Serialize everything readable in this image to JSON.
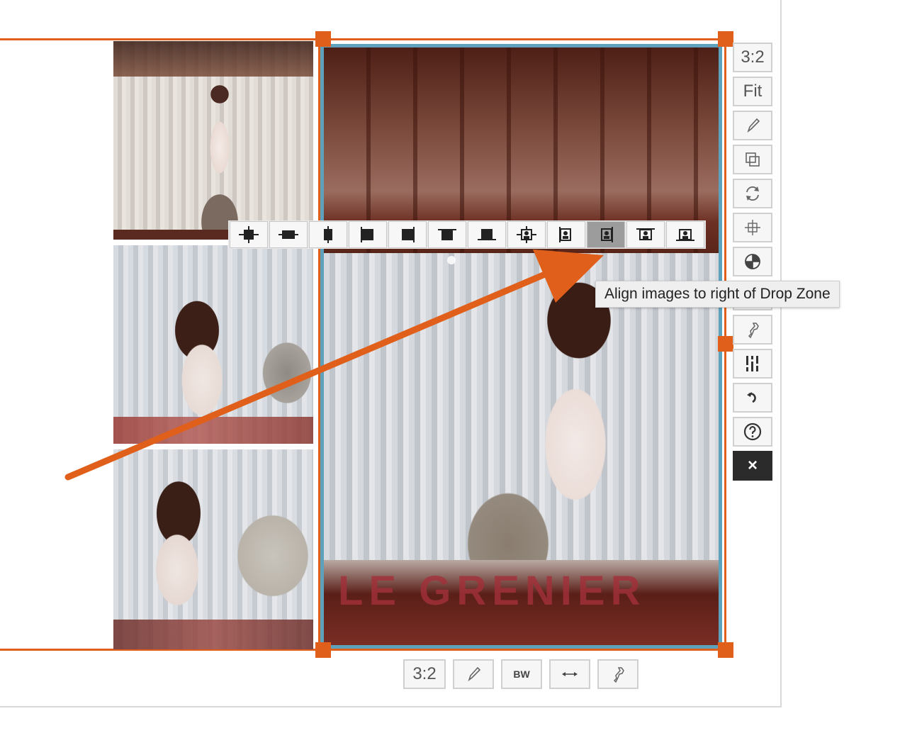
{
  "align_toolbar": {
    "buttons": [
      {
        "name": "align-center-both-button"
      },
      {
        "name": "align-center-horizontal-button"
      },
      {
        "name": "align-center-vertical-button"
      },
      {
        "name": "align-left-button"
      },
      {
        "name": "align-right-button"
      },
      {
        "name": "align-top-button"
      },
      {
        "name": "align-bottom-button"
      },
      {
        "name": "align-images-center-dropzone-button"
      },
      {
        "name": "align-images-left-dropzone-button"
      },
      {
        "name": "align-images-right-dropzone-button",
        "active": true
      },
      {
        "name": "align-images-top-dropzone-button"
      },
      {
        "name": "align-images-bottom-dropzone-button"
      }
    ]
  },
  "tooltip": {
    "text": "Align images to right of Drop Zone"
  },
  "side_toolbar": {
    "ratio_label": "3:2",
    "fit_label": "Fit",
    "bw_label": "BW",
    "close_label": "×"
  },
  "bottom_toolbar": {
    "ratio_label": "3:2",
    "bw_label": "BW"
  },
  "main_photo": {
    "sign_text": "LE GRENIER"
  },
  "colors": {
    "selection_orange": "#e0601b",
    "frame_blue": "#5da1bd",
    "close_button_bg": "#2b2b2b"
  }
}
